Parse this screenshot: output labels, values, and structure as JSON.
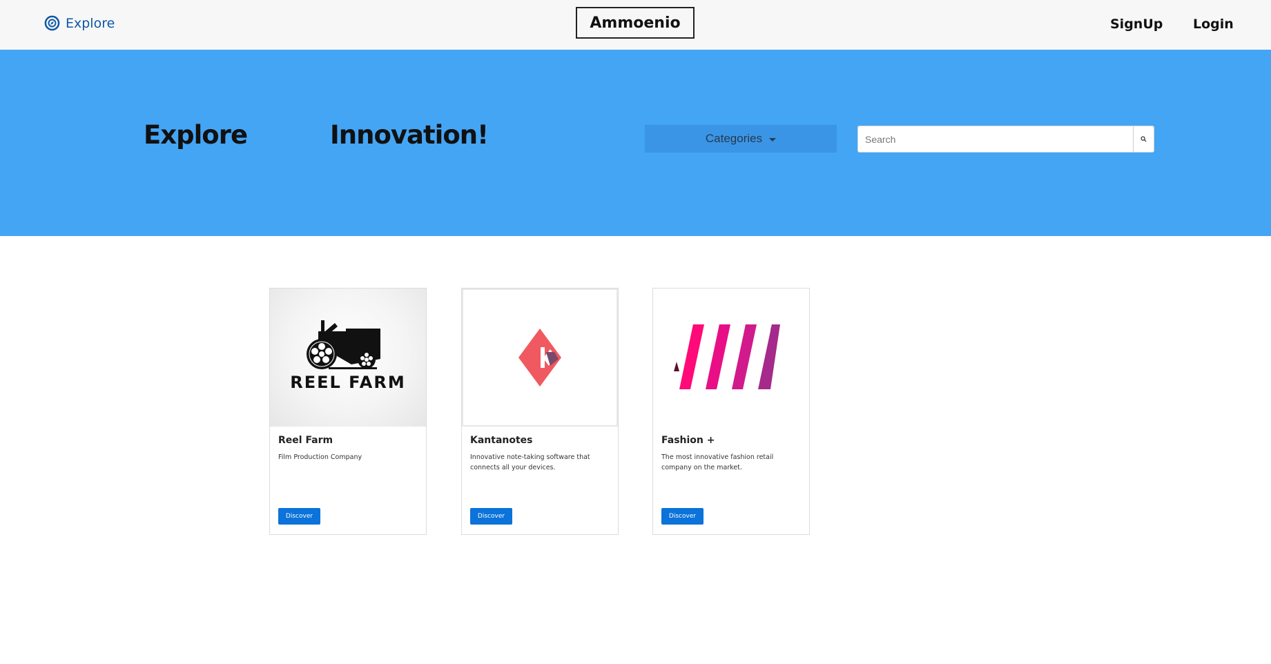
{
  "nav": {
    "explore_label": "Explore",
    "brand": "Ammoenio",
    "signup_label": "SignUp",
    "login_label": "Login"
  },
  "hero": {
    "word1": "Explore",
    "word2": "Innovation!",
    "categories_label": "Categories",
    "search_placeholder": "Search"
  },
  "colors": {
    "hero_bg": "#44a5f5",
    "nav_link": "#0d57a6",
    "button": "#0b73d9"
  },
  "cards": [
    {
      "title": "Reel Farm",
      "description": "Film Production Company",
      "button": "Discover",
      "logo_text": "REEL FARM"
    },
    {
      "title": "Kantanotes",
      "description": "Innovative note-taking software that connects all your devices.",
      "button": "Discover"
    },
    {
      "title": "Fashion +",
      "description": "The most innovative fashion retail company on the market.",
      "button": "Discover"
    }
  ]
}
